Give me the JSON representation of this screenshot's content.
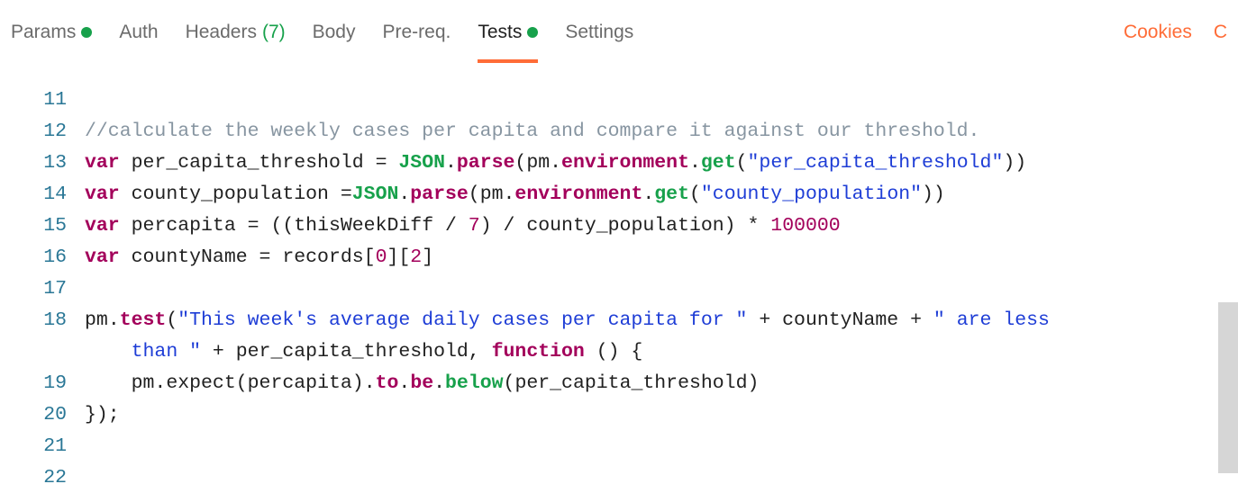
{
  "tabs": {
    "params": "Params",
    "auth": "Auth",
    "headers": "Headers",
    "headers_count": "(7)",
    "body": "Body",
    "prereq": "Pre-req.",
    "tests": "Tests",
    "settings": "Settings"
  },
  "right": {
    "cookies": "Cookies",
    "c_trunc": "C"
  },
  "code": {
    "l11_num": "11",
    "l12_num": "12",
    "l12_comment": "//calculate the weekly cases per capita and compare it against our threshold.",
    "l13_num": "13",
    "l13": {
      "var": "var",
      "name": " per_capita_threshold ",
      "eq": "=",
      "json": " JSON",
      "dot1": ".",
      "parse": "parse",
      "op": "(pm",
      "dot2": ".",
      "env": "environment",
      "dot3": ".",
      "get": "get",
      "op2": "(",
      "str": "\"per_capita_threshold\"",
      "cl": "))"
    },
    "l14_num": "14",
    "l14": {
      "var": "var",
      "name": " county_population ",
      "eq": "=",
      "json": "JSON",
      "dot1": ".",
      "parse": "parse",
      "op": "(pm",
      "dot2": ".",
      "env": "environment",
      "dot3": ".",
      "get": "get",
      "op2": "(",
      "str": "\"county_population\"",
      "cl": "))"
    },
    "l15_num": "15",
    "l15": {
      "var": "var",
      "name": " percapita ",
      "eq": "=",
      "expr1": " ((thisWeekDiff ",
      "div": "/",
      "seven": " 7",
      "expr2": ") ",
      "div2": "/",
      "expr3": " county_population) ",
      "mul": "*",
      "num": " 100000"
    },
    "l16_num": "16",
    "l16": {
      "var": "var",
      "name": " countyName ",
      "eq": "=",
      "expr1": " records[",
      "zero": "0",
      "mid": "][",
      "two": "2",
      "end": "]"
    },
    "l17_num": "17",
    "l18_num": "18",
    "l18a": {
      "pm": "pm",
      "dot": ".",
      "test": "test",
      "op": "(",
      "str1": "\"This week's average daily cases per capita for \"",
      "plus": " + ",
      "cn": "countyName",
      "plus2": " + ",
      "str2": "\" are less",
      "cont_indent": "    ",
      "cont_str": "than \"",
      "plus3": " + ",
      "pct": "per_capita_threshold",
      "comma": ", ",
      "func": "function",
      "tail": " () {"
    },
    "l19_num": "19",
    "l19": {
      "indent": "    ",
      "pm": "pm",
      "dot": ".",
      "expect": "expect",
      "rest": "(percapita)",
      "dot2": ".",
      "to": "to",
      "dot3": ".",
      "be": "be",
      "dot4": ".",
      "below": "below",
      "tail": "(per_capita_threshold)"
    },
    "l20_num": "20",
    "l20": "});",
    "l21_num": "21",
    "l22_num": "22"
  }
}
